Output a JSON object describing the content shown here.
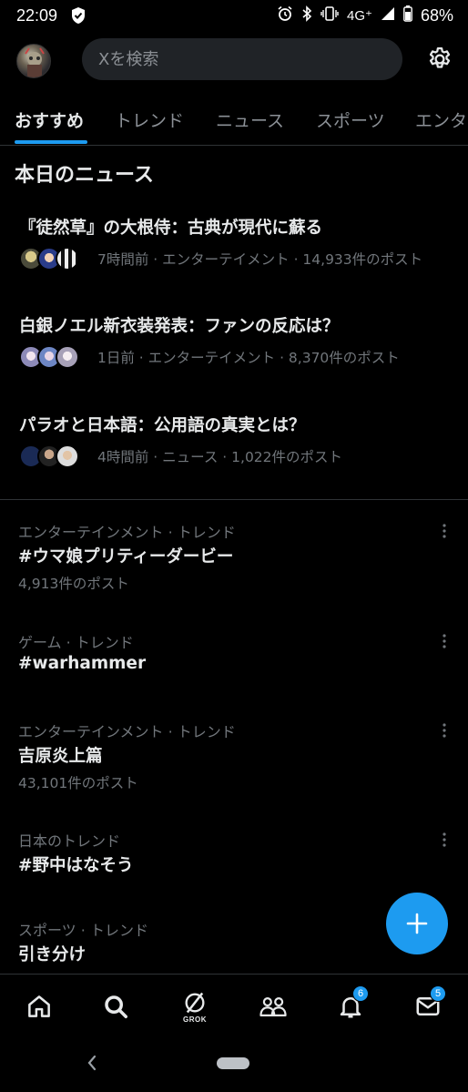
{
  "status_bar": {
    "time": "22:09",
    "network": "4G⁺",
    "battery": "68%"
  },
  "header": {
    "search_placeholder": "Xを検索"
  },
  "tabs": [
    {
      "label": "おすすめ",
      "active": true
    },
    {
      "label": "トレンド",
      "active": false
    },
    {
      "label": "ニュース",
      "active": false
    },
    {
      "label": "スポーツ",
      "active": false
    },
    {
      "label": "エンタ",
      "active": false
    }
  ],
  "today_news": {
    "title": "本日のニュース",
    "items": [
      {
        "title": "『徒然草』の大根侍：古典が現代に蘇る",
        "meta": "7時間前 · エンターテイメント · 14,933件のポスト"
      },
      {
        "title": "白銀ノエル新衣装発表：ファンの反応は？",
        "meta": "1日前 · エンターテイメント · 8,370件のポスト"
      },
      {
        "title": "パラオと日本語：公用語の真実とは？",
        "meta": "4時間前 · ニュース · 1,022件のポスト"
      }
    ]
  },
  "trends": [
    {
      "context": "エンターテインメント · トレンド",
      "name": "#ウマ娘プリティーダービー",
      "count": "4,913件のポスト"
    },
    {
      "context": "ゲーム · トレンド",
      "name": "#warhammer",
      "count": ""
    },
    {
      "context": "エンターテインメント · トレンド",
      "name": "吉原炎上篇",
      "count": "43,101件のポスト"
    },
    {
      "context": "日本のトレンド",
      "name": "#野中はなそう",
      "count": ""
    },
    {
      "context": "スポーツ · トレンド",
      "name": "引き分け",
      "count": ""
    }
  ],
  "bottom_nav": {
    "grok_label": "GROK",
    "notifications_badge": "6",
    "messages_badge": "5"
  },
  "colors": {
    "accent": "#1d9bf0",
    "background": "#000000",
    "secondary_text": "#71767b"
  }
}
